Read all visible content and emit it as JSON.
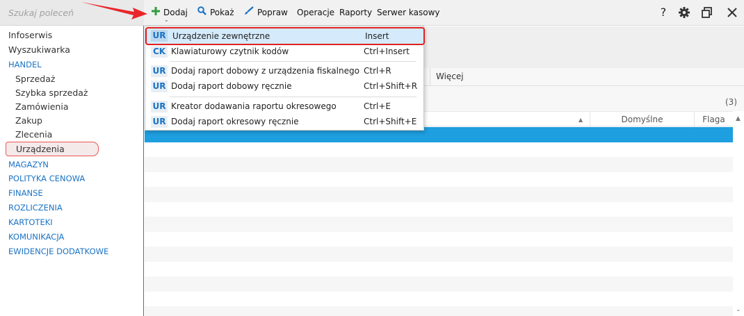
{
  "search": {
    "placeholder": "Szukaj poleceń"
  },
  "sidebar": {
    "items": [
      {
        "label": "Infoserwis",
        "kind": "item"
      },
      {
        "label": "Wyszukiwarka",
        "kind": "item"
      },
      {
        "label": "HANDEL",
        "kind": "section"
      },
      {
        "label": "Sprzedaż",
        "kind": "sub"
      },
      {
        "label": "Szybka sprzedaż",
        "kind": "sub"
      },
      {
        "label": "Zamówienia",
        "kind": "sub"
      },
      {
        "label": "Zakup",
        "kind": "sub"
      },
      {
        "label": "Zlecenia",
        "kind": "sub"
      },
      {
        "label": "Urządzenia",
        "kind": "sub",
        "selected": true
      },
      {
        "label": "MAGAZYN",
        "kind": "section"
      },
      {
        "label": "POLITYKA CENOWA",
        "kind": "section"
      },
      {
        "label": "FINANSE",
        "kind": "section"
      },
      {
        "label": "ROZLICZENIA",
        "kind": "section"
      },
      {
        "label": "KARTOTEKI",
        "kind": "section"
      },
      {
        "label": "KOMUNIKACJA",
        "kind": "section"
      },
      {
        "label": "EWIDENCJE DODATKOWE",
        "kind": "section"
      }
    ]
  },
  "toolbar": {
    "add_label": "Dodaj",
    "show_label": "Pokaż",
    "edit_label": "Popraw",
    "operations_label": "Operacje",
    "reports_label": "Raporty",
    "cash_server_label": "Serwer kasowy",
    "help_label": "?",
    "icons": {
      "add": "plus-icon",
      "show": "magnifier-icon",
      "edit": "brush-icon",
      "settings": "gear-icon",
      "restore": "restore-window-icon",
      "close": "close-icon"
    }
  },
  "menu": {
    "items": [
      {
        "code": "UR",
        "label": "Urządzenie zewnętrzne",
        "shortcut": "Insert"
      },
      {
        "code": "CK",
        "label": "Klawiaturowy czytnik kodów",
        "shortcut": "Ctrl+Insert"
      },
      {
        "code": "UR",
        "label": "Dodaj raport dobowy z urządzenia fiskalnego",
        "shortcut": "Ctrl+R"
      },
      {
        "code": "UR",
        "label": "Dodaj raport dobowy ręcznie",
        "shortcut": "Ctrl+Shift+R"
      },
      {
        "code": "UR",
        "label": "Kreator dodawania raportu okresowego",
        "shortcut": "Ctrl+E"
      },
      {
        "code": "UR",
        "label": "Dodaj raport okresowy ręcznie",
        "shortcut": "Ctrl+Shift+E"
      }
    ]
  },
  "main": {
    "tab_more": "Więcej",
    "record_count": "(3)",
    "columns": {
      "default": "Domyślne",
      "flag": "Flaga"
    }
  },
  "colors": {
    "accent": "#1b73c4",
    "selection": "#1e9fe0",
    "highlight_border": "#e02020",
    "add_icon": "#2e9e3e"
  }
}
